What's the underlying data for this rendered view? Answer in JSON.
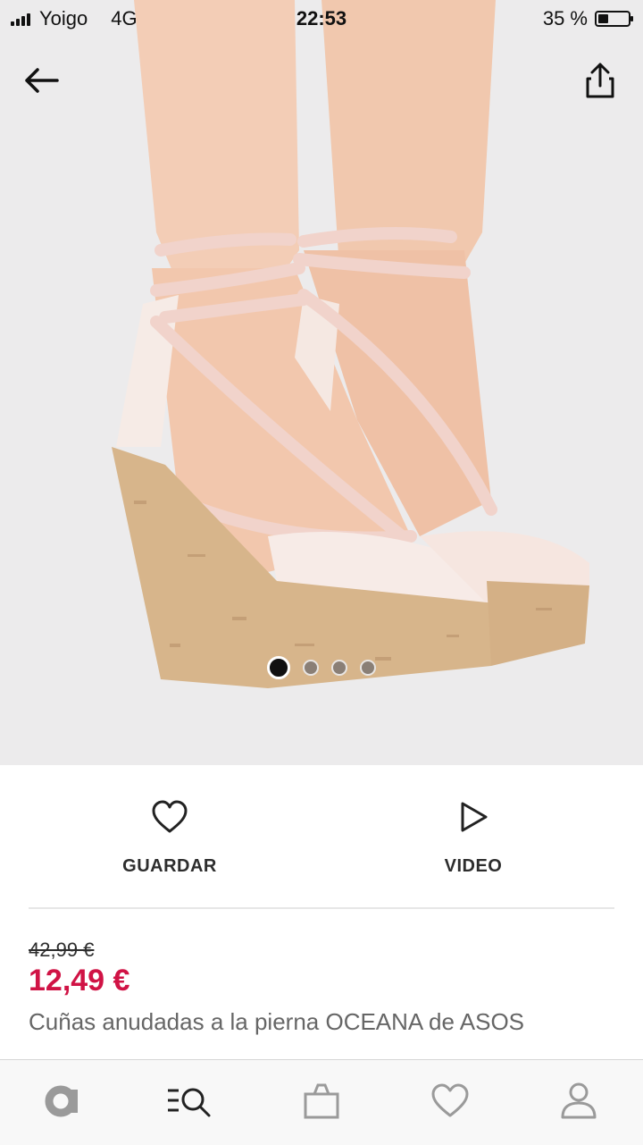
{
  "status": {
    "carrier": "Yoigo",
    "network": "4G",
    "time": "22:53",
    "battery_text": "35 %",
    "battery_level": 0.35
  },
  "gallery": {
    "image_count": 4,
    "active_index": 0
  },
  "icons": {
    "back": "arrow-left-icon",
    "share": "share-icon",
    "save": "heart-icon",
    "video": "play-icon"
  },
  "actions": {
    "save_label": "GUARDAR",
    "video_label": "VIDEO"
  },
  "product": {
    "old_price": "42,99 €",
    "new_price": "12,49 €",
    "title": "Cuñas anudadas a la pierna OCEANA de ASOS"
  },
  "bottom_nav": [
    "home-logo-icon",
    "search-menu-icon",
    "bag-icon",
    "saved-heart-icon",
    "account-icon"
  ],
  "colors": {
    "sale_price": "#d01345",
    "text": "#2d2d2d",
    "muted": "#666666"
  }
}
